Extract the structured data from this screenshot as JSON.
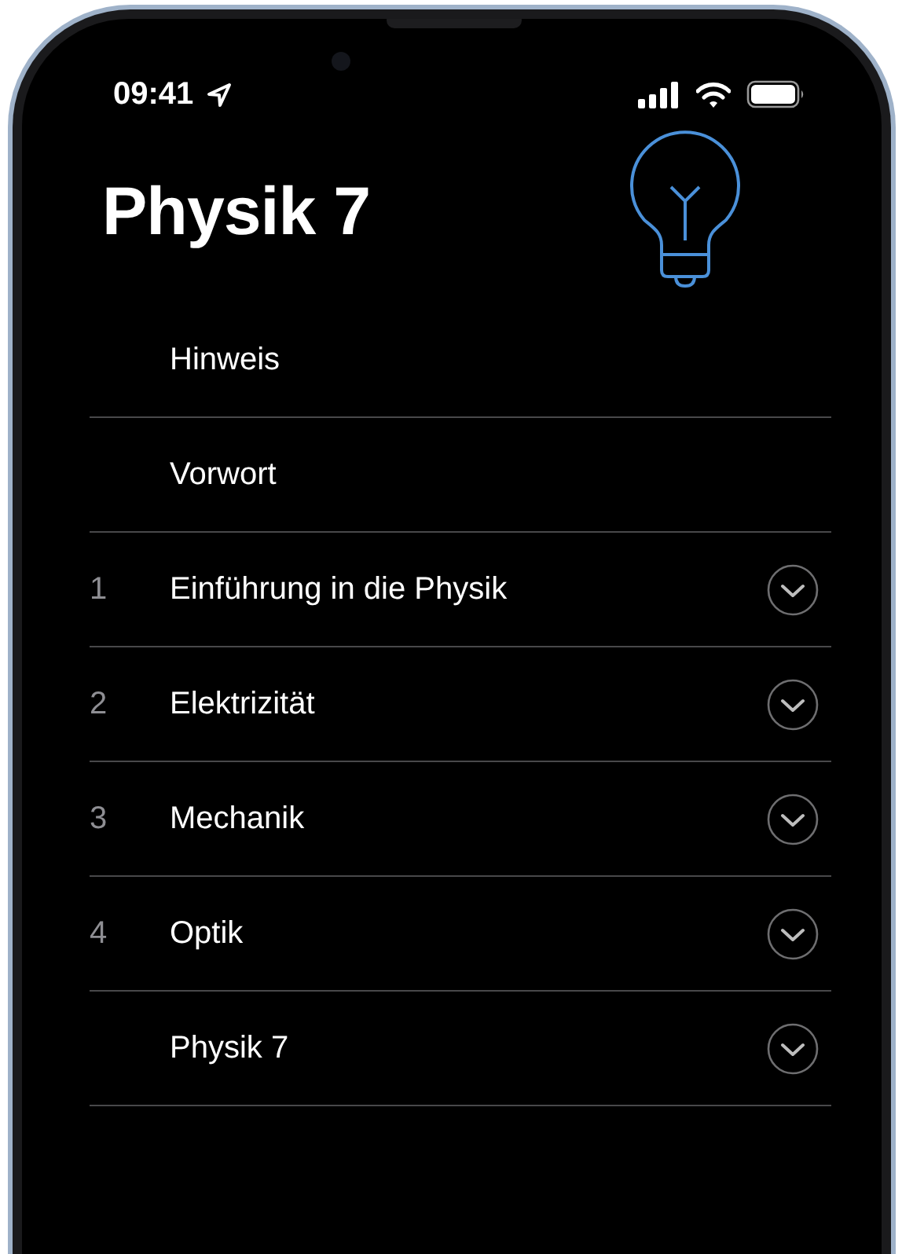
{
  "status_bar": {
    "time": "09:41"
  },
  "title": "Physik 7",
  "items": [
    {
      "label": "Hinweis",
      "expandable": false
    },
    {
      "label": "Vorwort",
      "expandable": false
    },
    {
      "number": "1",
      "label": "Einführung in die Physik",
      "expandable": true
    },
    {
      "number": "2",
      "label": "Elektrizität",
      "expandable": true
    },
    {
      "number": "3",
      "label": "Mechanik",
      "expandable": true
    },
    {
      "number": "4",
      "label": "Optik",
      "expandable": true
    },
    {
      "label": "Physik 7",
      "expandable": true
    }
  ]
}
